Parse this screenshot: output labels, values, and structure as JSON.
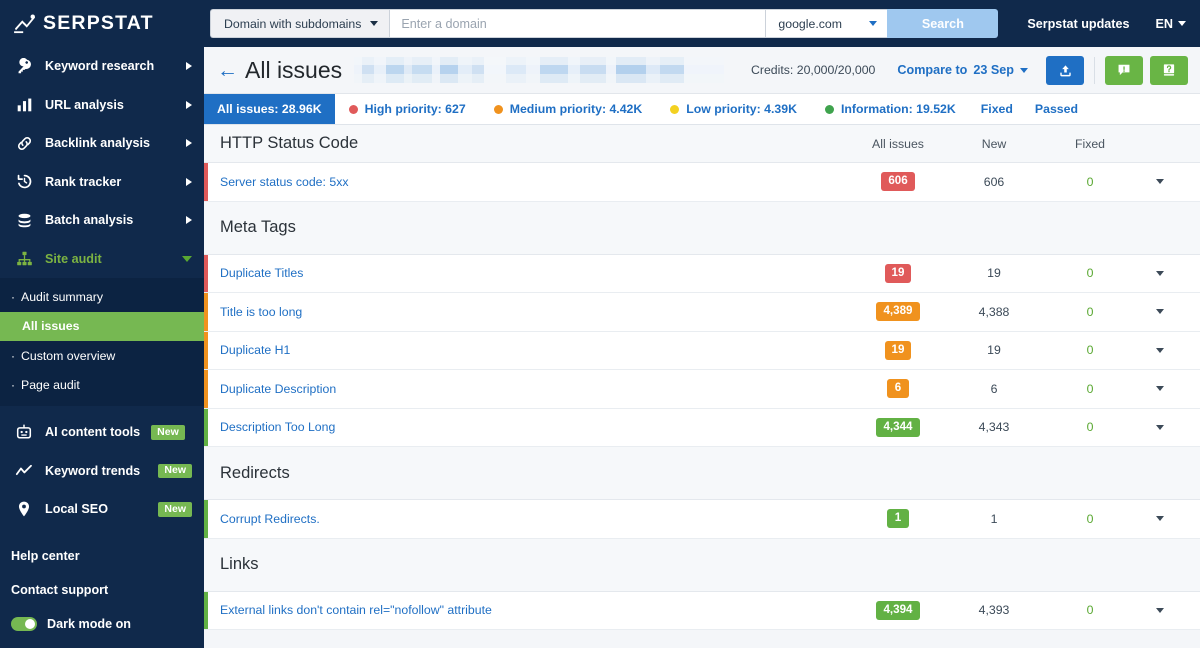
{
  "brand": {
    "name": "SERPSTAT"
  },
  "sidebar": {
    "nav": [
      {
        "label": "Keyword research",
        "icon": "key-icon",
        "expandable": true
      },
      {
        "label": "URL analysis",
        "icon": "bar-chart-icon",
        "expandable": true
      },
      {
        "label": "Backlink analysis",
        "icon": "link-icon",
        "expandable": true
      },
      {
        "label": "Rank tracker",
        "icon": "history-icon",
        "expandable": true
      },
      {
        "label": "Batch analysis",
        "icon": "database-icon",
        "expandable": true
      },
      {
        "label": "Site audit",
        "icon": "sitemap-icon",
        "expandable": true,
        "active": true
      }
    ],
    "subnav": [
      {
        "label": "Audit summary",
        "bullet": "·",
        "selected": false
      },
      {
        "label": "All issues",
        "bullet": "",
        "selected": true
      },
      {
        "label": "Custom overview",
        "bullet": "·",
        "selected": false
      },
      {
        "label": "Page audit",
        "bullet": "·",
        "selected": false
      }
    ],
    "tools": [
      {
        "label": "AI content tools",
        "icon": "robot-icon",
        "badge": "New",
        "expandable": true
      },
      {
        "label": "Keyword trends",
        "icon": "trend-line-icon",
        "badge": "New",
        "expandable": false
      },
      {
        "label": "Local SEO",
        "icon": "map-pin-icon",
        "badge": "New",
        "expandable": false
      }
    ],
    "footer": [
      {
        "label": "Help center"
      },
      {
        "label": "Contact support"
      }
    ],
    "dark_mode": {
      "label": "Dark mode on",
      "on": true
    }
  },
  "topbar": {
    "scope_select": "Domain with subdomains",
    "domain_placeholder": "Enter a domain",
    "domain_value": "",
    "engine_select": "google.com",
    "search_button": "Search",
    "updates_link": "Serpstat updates",
    "language": "EN"
  },
  "titlebar": {
    "back": "←",
    "title": "All issues",
    "redacted": true,
    "credits": "Credits: 20,000/20,000",
    "compare_label": "Compare to",
    "compare_date": "23 Sep",
    "export_icon": "upload-icon",
    "feedback_icon": "feedback-icon",
    "help_icon": "help-icon"
  },
  "tabs": {
    "active": "All issues: 28.96K",
    "items": [
      {
        "label": "All issues: 28.96K",
        "color": "",
        "active": true
      },
      {
        "label": "High priority: 627",
        "color": "#e05a5a",
        "active": false
      },
      {
        "label": "Medium priority: 4.42K",
        "color": "#f0921e",
        "active": false
      },
      {
        "label": "Low priority: 4.39K",
        "color": "#f3d121",
        "active": false
      },
      {
        "label": "Information: 19.52K",
        "color": "#3fa34d",
        "active": false
      },
      {
        "label": "Fixed",
        "color": "",
        "active": false
      },
      {
        "label": "Passed",
        "color": "",
        "active": false
      }
    ]
  },
  "table": {
    "columns": {
      "all": "All issues",
      "new": "New",
      "fixed": "Fixed"
    },
    "sections": [
      {
        "title": "HTTP Status Code",
        "show_columns": true,
        "rows": [
          {
            "name": "Server status code: 5xx",
            "all": "606",
            "new": "606",
            "fixed": "0",
            "severity": "high",
            "badge_color": "#e05a5a"
          }
        ]
      },
      {
        "title": "Meta Tags",
        "show_columns": false,
        "rows": [
          {
            "name": "Duplicate Titles",
            "all": "19",
            "new": "19",
            "fixed": "0",
            "severity": "high",
            "badge_color": "#e05a5a"
          },
          {
            "name": "Title is too long",
            "all": "4,389",
            "new": "4,388",
            "fixed": "0",
            "severity": "medium",
            "badge_color": "#f0921e"
          },
          {
            "name": "Duplicate H1",
            "all": "19",
            "new": "19",
            "fixed": "0",
            "severity": "medium",
            "badge_color": "#f0921e"
          },
          {
            "name": "Duplicate Description",
            "all": "6",
            "new": "6",
            "fixed": "0",
            "severity": "medium",
            "badge_color": "#f0921e"
          },
          {
            "name": "Description Too Long",
            "all": "4,344",
            "new": "4,343",
            "fixed": "0",
            "severity": "info",
            "badge_color": "#62b144"
          }
        ]
      },
      {
        "title": "Redirects",
        "show_columns": false,
        "rows": [
          {
            "name": "Corrupt Redirects.",
            "all": "1",
            "new": "1",
            "fixed": "0",
            "severity": "info",
            "badge_color": "#62b144"
          }
        ]
      },
      {
        "title": "Links",
        "show_columns": false,
        "rows": [
          {
            "name": "External links don't contain rel=\"nofollow\" attribute",
            "all": "4,394",
            "new": "4,393",
            "fixed": "0",
            "severity": "info",
            "badge_color": "#62b144"
          }
        ]
      }
    ]
  },
  "colors": {
    "sidebar_bg": "#10294b",
    "subnav_bg": "#0c2342",
    "accent_green": "#76b852",
    "accent_blue": "#1f6fc4",
    "high": "#e05a5a",
    "medium": "#f0921e",
    "low": "#f3d121",
    "info": "#3fa34d"
  }
}
